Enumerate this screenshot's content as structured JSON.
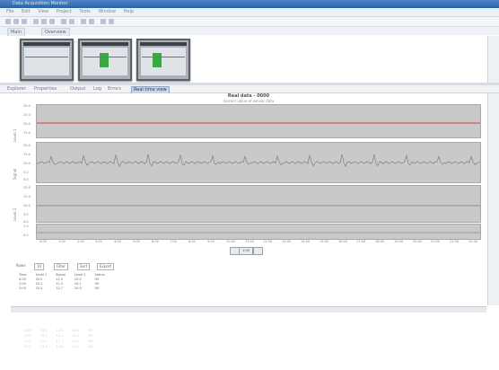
{
  "window": {
    "title": "Data Acquisition Monitor"
  },
  "menu": [
    "File",
    "Edit",
    "View",
    "Project",
    "Tools",
    "Window",
    "Help"
  ],
  "tabs": [
    "Main",
    "Overview"
  ],
  "view_tabs": [
    "Explorer",
    "Properties",
    "Output",
    "Log",
    "Errors",
    "Real time view"
  ],
  "chart": {
    "title": "Real data - 0000",
    "subtitle": "current value of sensor data",
    "panels": [
      {
        "ylabel": "Level 1",
        "yticks": [
          "30.0",
          "25.0",
          "20.0",
          "15.0"
        ],
        "line_color": "#d04040"
      },
      {
        "ylabel": "Signal",
        "yticks": [
          "20.0",
          "15.0",
          "10.0",
          "5.0",
          "0.0"
        ],
        "line_color": "#7f8a96"
      },
      {
        "ylabel": "Level 2",
        "yticks": [
          "20.0",
          "15.0",
          "10.0",
          "5.0",
          "0.0"
        ],
        "line_color": "#6f7b88"
      },
      {
        "ylabel": "",
        "yticks": [
          "1.0",
          "0.0"
        ],
        "line_color": "#7f8a96"
      }
    ],
    "xticks": [
      "0:00",
      "1:00",
      "2:00",
      "3:00",
      "4:00",
      "5:00",
      "6:00",
      "7:00",
      "8:00",
      "9:00",
      "10:00",
      "11:00",
      "12:00",
      "13:00",
      "14:00",
      "15:00",
      "16:00",
      "17:00",
      "18:00",
      "19:00",
      "20:00",
      "21:00",
      "22:00",
      "23:00"
    ],
    "nav_value": "1:00"
  },
  "table_toolbar": {
    "rows_label": "Rows",
    "rows_value": "10",
    "filter_label": "Filter",
    "sort_label": "Sort",
    "export_label": "Export"
  },
  "table": {
    "headers": [
      "Time",
      "Level 1",
      "Signal",
      "Level 2",
      "Status"
    ],
    "rows": [
      [
        "0:00",
        "25.0",
        "12.5",
        "10.0",
        "OK"
      ],
      [
        "1:00",
        "25.1",
        "12.3",
        "10.1",
        "OK"
      ],
      [
        "2:00",
        "25.0",
        "12.7",
        "10.0",
        "OK"
      ]
    ]
  },
  "ghost_table": {
    "rows": [
      [
        "0:00",
        "25.0",
        "12.5",
        "10.0",
        "OK"
      ],
      [
        "1:00",
        "25.1",
        "12.3",
        "10.1",
        "OK"
      ],
      [
        "2:00",
        "25.0",
        "12.7",
        "10.0",
        "OK"
      ],
      [
        "3:00",
        "24.9",
        "12.6",
        "10.2",
        "OK"
      ]
    ]
  }
}
